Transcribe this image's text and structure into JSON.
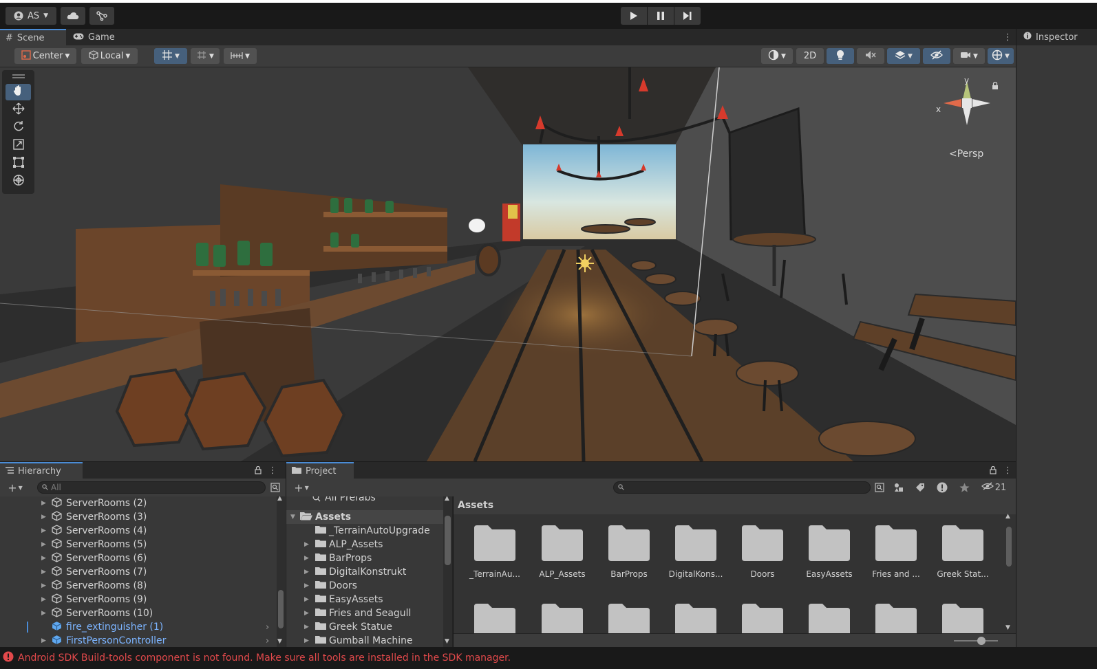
{
  "topbar": {
    "account_label": "AS"
  },
  "scene_panel": {
    "tabs": [
      {
        "label": "Scene",
        "active": true
      },
      {
        "label": "Game",
        "active": false
      }
    ],
    "pivot_label": "Center",
    "space_label": "Local",
    "mode_2d_label": "2D",
    "camera_mode_label": "Persp",
    "gizmo_axes": {
      "x": "x",
      "y": "y"
    }
  },
  "inspector": {
    "tab_label": "Inspector"
  },
  "hierarchy": {
    "tab_label": "Hierarchy",
    "search_placeholder": "All",
    "items": [
      {
        "label": "ServerRooms (2)",
        "type": "object"
      },
      {
        "label": "ServerRooms (3)",
        "type": "object"
      },
      {
        "label": "ServerRooms (4)",
        "type": "object"
      },
      {
        "label": "ServerRooms (5)",
        "type": "object"
      },
      {
        "label": "ServerRooms (6)",
        "type": "object"
      },
      {
        "label": "ServerRooms (7)",
        "type": "object"
      },
      {
        "label": "ServerRooms (8)",
        "type": "object"
      },
      {
        "label": "ServerRooms (9)",
        "type": "object"
      },
      {
        "label": "ServerRooms (10)",
        "type": "object"
      },
      {
        "label": "fire_extinguisher (1)",
        "type": "prefab"
      },
      {
        "label": "FirstPersonController",
        "type": "prefab"
      }
    ]
  },
  "project": {
    "tab_label": "Project",
    "hidden_count": "21",
    "tree_top_label": "All Prefabs",
    "tree_root_label": "Assets",
    "tree_items": [
      "_TerrainAutoUpgrade",
      "ALP_Assets",
      "BarProps",
      "DigitalKonstrukt",
      "Doors",
      "EasyAssets",
      "Fries and Seagull",
      "Greek Statue",
      "Gumball Machine"
    ],
    "grid_title": "Assets",
    "grid_items": [
      "_TerrainAu...",
      "ALP_Assets",
      "BarProps",
      "DigitalKons...",
      "Doors",
      "EasyAssets",
      "Fries and ...",
      "Greek Stat..."
    ]
  },
  "status": {
    "message": "Android SDK Build-tools component is not found. Make sure all tools are installed in the SDK manager.",
    "color": "#e2494b"
  },
  "colors": {
    "accent": "#4a8cd6",
    "prefab_text": "#7cb4ff",
    "toggle_on": "#46607c"
  }
}
